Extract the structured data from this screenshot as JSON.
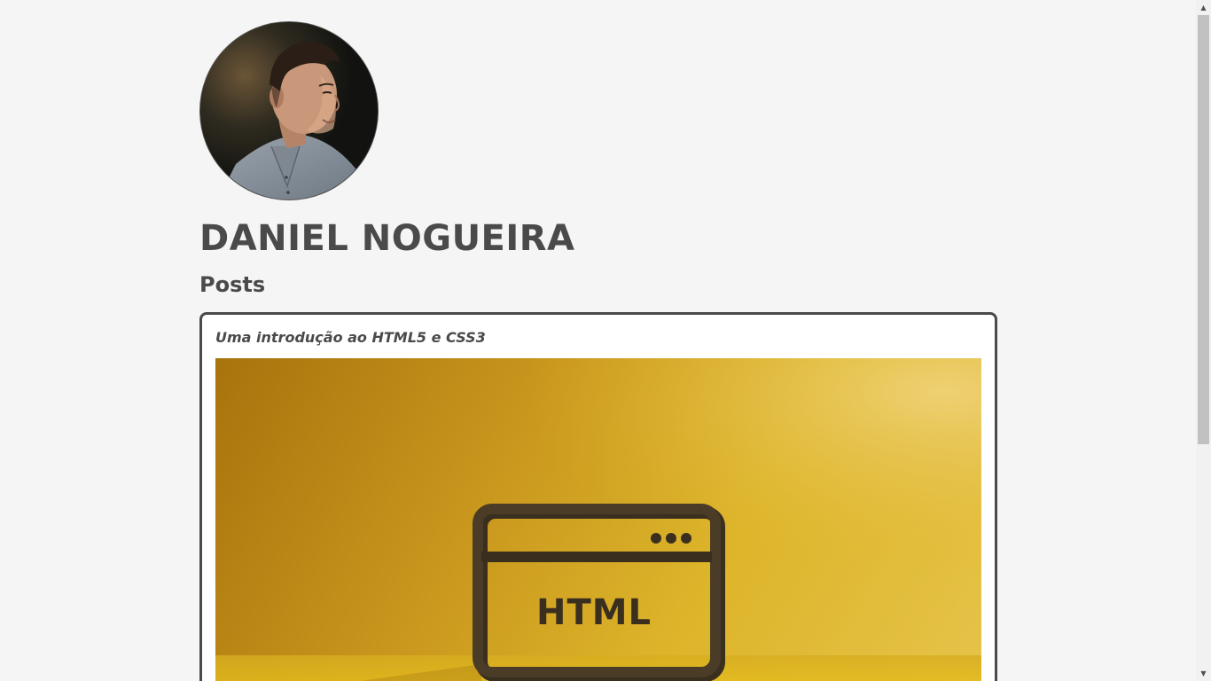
{
  "profile": {
    "name": "DANIEL NOGUEIRA"
  },
  "posts_section": {
    "heading": "Posts",
    "items": [
      {
        "title": "Uma introdução ao HTML5 e CSS3",
        "image_text": "HTML"
      }
    ]
  },
  "icons": {
    "scroll_up": "▲",
    "scroll_down": "▼"
  },
  "colors": {
    "background": "#f5f5f5",
    "text": "#4a4a4a",
    "card_border": "#4a4a4a",
    "image_yellow": "#ddb52a"
  }
}
